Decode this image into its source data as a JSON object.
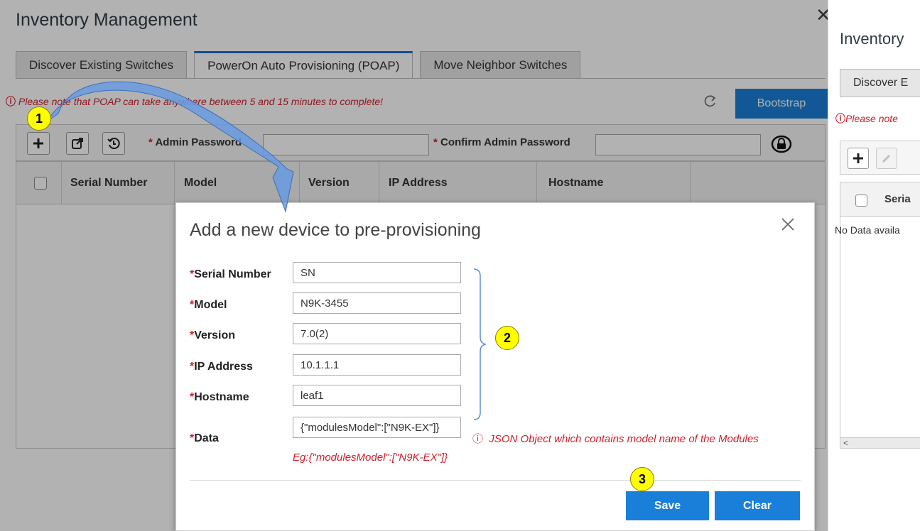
{
  "main": {
    "title": "Inventory Management",
    "tabs": [
      {
        "label": "Discover Existing Switches",
        "active": false
      },
      {
        "label": "PowerOn Auto Provisioning (POAP)",
        "active": true
      },
      {
        "label": "Move Neighbor Switches",
        "active": false
      }
    ],
    "warning": "Please note that POAP can take anywhere between 5 and 15 minutes to complete!",
    "bootstrap_label": "Bootstrap",
    "admin_password_label": "Admin Password",
    "confirm_password_label": "Confirm Admin Password",
    "columns": [
      "Serial Number",
      "Model",
      "Version",
      "IP Address",
      "Hostname"
    ]
  },
  "right_panel": {
    "title": "Inventory",
    "tab_label": "Discover E",
    "warning": "Please note",
    "column": "Seria",
    "no_data": "No Data availa"
  },
  "modal": {
    "title": "Add a new device to pre-provisioning",
    "fields": [
      {
        "label": "Serial Number",
        "value": "SN"
      },
      {
        "label": "Model",
        "value": "N9K-3455"
      },
      {
        "label": "Version",
        "value": "7.0(2)"
      },
      {
        "label": "IP Address",
        "value": "10.1.1.1"
      },
      {
        "label": "Hostname",
        "value": "leaf1"
      },
      {
        "label": "Data",
        "value": "{\"modulesModel\":[\"N9K-EX\"]}"
      }
    ],
    "data_hint": "JSON Object which contains model name of the Modules",
    "data_example": "Eg:{\"modulesModel\":[\"N9K-EX\"]}",
    "save_label": "Save",
    "clear_label": "Clear"
  },
  "callouts": {
    "c1": "1",
    "c2": "2",
    "c3": "3"
  },
  "required_mark": "*",
  "colors": {
    "accent": "#1a7fd8",
    "error": "#cc1f2b",
    "callout": "#ffff00",
    "arrow": "#5b8fd6"
  },
  "icons": [
    "plus-icon",
    "share-icon",
    "history-icon",
    "refresh-icon",
    "lock-icon",
    "close-icon",
    "info-icon",
    "pencil-icon"
  ]
}
